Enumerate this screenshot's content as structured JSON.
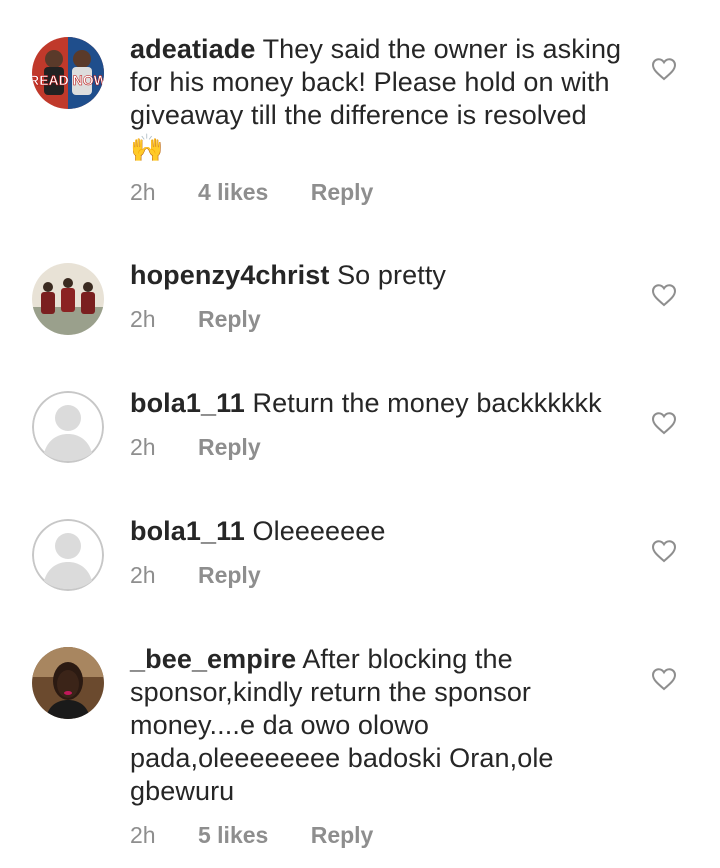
{
  "comments": [
    {
      "username": "adeatiade",
      "text": "They said the owner is asking for his money back! Please hold on with giveaway till the difference is resolved",
      "emoji": "🙌",
      "time": "2h",
      "likes": "4 likes",
      "reply": "Reply",
      "avatar_text": "READ NOW",
      "avatar_icon": "profile-photo-red"
    },
    {
      "username": "hopenzy4christ",
      "text": "So pretty",
      "time": "2h",
      "reply": "Reply",
      "avatar_icon": "profile-photo-people"
    },
    {
      "username": "bola1_11",
      "text": "Return the money backkkkkk",
      "time": "2h",
      "reply": "Reply",
      "avatar_icon": "default-avatar"
    },
    {
      "username": "bola1_11",
      "text": "Oleeeeeee",
      "time": "2h",
      "reply": "Reply",
      "avatar_icon": "default-avatar"
    },
    {
      "username": "_bee_empire",
      "text": "After blocking the sponsor,kindly return the sponsor money....e da owo olowo pada,oleeeeeeee badoski Oran,ole gbewuru",
      "time": "2h",
      "likes": "5 likes",
      "reply": "Reply",
      "avatar_icon": "profile-photo-woman"
    }
  ],
  "colors": {
    "text": "#262626",
    "meta": "#8e8e8e",
    "heart_outline": "#8e8e8e",
    "default_avatar_bg": "#dbdbdb"
  },
  "icons": {
    "like": "heart-outline-icon"
  }
}
